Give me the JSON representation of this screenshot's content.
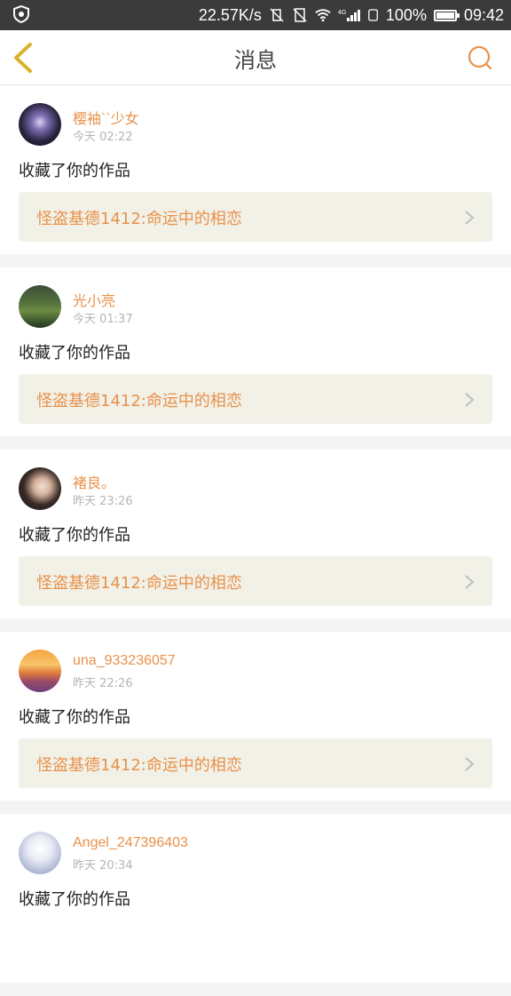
{
  "statusbar": {
    "speed": "22.57K/s",
    "battery": "100%",
    "time": "09:42",
    "battery_fill": 1.0
  },
  "header": {
    "title": "消息"
  },
  "colors": {
    "accent": "#e8914b",
    "back": "#d8b42e",
    "card_bg": "#f2f1e7",
    "statusbar": "#3b3b3b"
  },
  "messages": [
    {
      "user": "樱袖``少女",
      "time": "今天 02:22",
      "action": "收藏了你的作品",
      "work": "怪盗基德1412:命运中的相恋"
    },
    {
      "user": "光小亮",
      "time": "今天 01:37",
      "action": "收藏了你的作品",
      "work": "怪盗基德1412:命运中的相恋"
    },
    {
      "user": "褚良。",
      "time": "昨天 23:26",
      "action": "收藏了你的作品",
      "work": "怪盗基德1412:命运中的相恋"
    },
    {
      "user": "una_933236057",
      "time": "昨天 22:26",
      "action": "收藏了你的作品",
      "work": "怪盗基德1412:命运中的相恋"
    },
    {
      "user": "Angel_247396403",
      "time": "昨天 20:34",
      "action": "收藏了你的作品",
      "work": ""
    }
  ]
}
